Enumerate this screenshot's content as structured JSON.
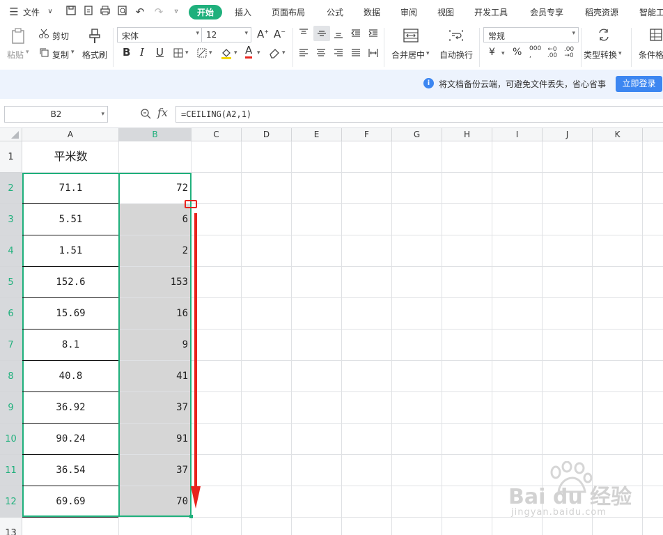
{
  "menu": {
    "file_label": "文件",
    "tabs": [
      "开始",
      "插入",
      "页面布局",
      "公式",
      "数据",
      "审阅",
      "视图",
      "开发工具",
      "会员专享",
      "稻壳资源",
      "智能工"
    ]
  },
  "ribbon": {
    "paste": "粘贴",
    "cut": "剪切",
    "copy": "复制",
    "format_painter": "格式刷",
    "font_name": "宋体",
    "font_size": "12",
    "merge_center": "合并居中",
    "wrap_text": "自动换行",
    "number_format": "常规",
    "type_convert": "类型转换",
    "conditional_format": "条件格",
    "currency_symbol": "¥",
    "percent_symbol": "%",
    "thousands_symbol": "000"
  },
  "notice": {
    "text": "将文档备份云端，可避免文件丢失，省心省事",
    "login_button": "立即登录"
  },
  "formula_bar": {
    "name_box": "B2",
    "fx_label": "fx",
    "formula": "=CEILING(A2,1)"
  },
  "columns": [
    "A",
    "B",
    "C",
    "D",
    "E",
    "F",
    "G",
    "H",
    "I",
    "J",
    "K"
  ],
  "rows": [
    "1",
    "2",
    "3",
    "4",
    "5",
    "6",
    "7",
    "8",
    "9",
    "10",
    "11",
    "12",
    "13"
  ],
  "header_row": {
    "a": "平米数",
    "b": ""
  },
  "data": [
    {
      "a": "71.1",
      "b": "72"
    },
    {
      "a": "5.51",
      "b": "6"
    },
    {
      "a": "1.51",
      "b": "2"
    },
    {
      "a": "152.6",
      "b": "153"
    },
    {
      "a": "15.69",
      "b": "16"
    },
    {
      "a": "8.1",
      "b": "9"
    },
    {
      "a": "40.8",
      "b": "41"
    },
    {
      "a": "36.92",
      "b": "37"
    },
    {
      "a": "90.24",
      "b": "91"
    },
    {
      "a": "36.54",
      "b": "37"
    },
    {
      "a": "69.69",
      "b": "70"
    }
  ],
  "watermark": {
    "brand": "Bai du 经验",
    "url": "jingyan.baidu.com"
  },
  "colors": {
    "accent": "#1fb07c",
    "link_blue": "#3c86f1",
    "annotation_red": "#e8231d",
    "selection_fill": "#d6d6d6"
  }
}
